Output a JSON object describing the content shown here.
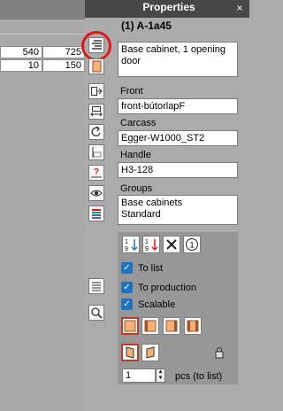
{
  "window": {
    "title": "Properties",
    "close_glyph": "×"
  },
  "object": {
    "title": "(1) A-1a45"
  },
  "dims": {
    "row1": [
      "540",
      "725"
    ],
    "row2": [
      "10",
      "150"
    ]
  },
  "fields": {
    "name": "Base cabinet, 1 opening\ndoor",
    "front_label": "Front",
    "front_value": "front-bútorlapF",
    "carcass_label": "Carcass",
    "carcass_value": "Egger-W1000_ST2",
    "handle_label": "Handle",
    "handle_value": "H3-128",
    "groups_label": "Groups",
    "groups_value": "Base cabinets\nStandard"
  },
  "options": {
    "to_list": "To list",
    "to_production": "To production",
    "scalable": "Scalable"
  },
  "quantity": {
    "value": "1",
    "unit_label": "pcs (to list)"
  },
  "sort_buttons": {
    "one": "1",
    "nine": "9",
    "circle_one": "1"
  },
  "tools": [
    "properties-list-icon",
    "color-swatch-icon",
    "move-icon",
    "resize-icon",
    "rotate-icon",
    "align-icon",
    "dimension-question-icon",
    "eye-icon",
    "layers-icon",
    "list-icon",
    "magnifier-icon"
  ],
  "colors": {
    "accent": "#1e73be",
    "highlight": "#e4161c",
    "header": "#474747"
  }
}
